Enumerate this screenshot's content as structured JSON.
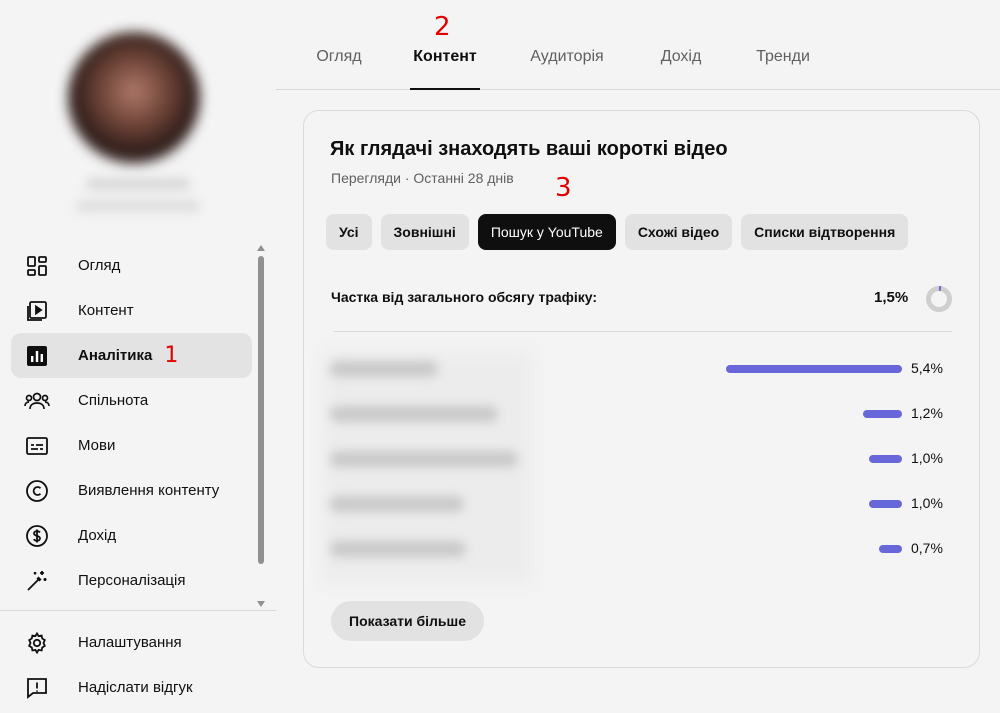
{
  "sidebar": {
    "items": [
      {
        "label": "Огляд",
        "icon": "dashboard-icon"
      },
      {
        "label": "Контент",
        "icon": "content-icon"
      },
      {
        "label": "Аналітика",
        "icon": "analytics-icon",
        "annotation": "1"
      },
      {
        "label": "Спільнота",
        "icon": "community-icon"
      },
      {
        "label": "Мови",
        "icon": "subtitles-icon"
      },
      {
        "label": "Виявлення контенту",
        "icon": "copyright-icon"
      },
      {
        "label": "Дохід",
        "icon": "dollar-icon"
      },
      {
        "label": "Персоналізація",
        "icon": "magic-wand-icon"
      }
    ],
    "bottom_items": [
      {
        "label": "Налаштування",
        "icon": "gear-icon"
      },
      {
        "label": "Надіслати відгук",
        "icon": "feedback-icon"
      }
    ]
  },
  "tabs": [
    {
      "label": "Огляд"
    },
    {
      "label": "Контент",
      "active": true,
      "annotation": "2"
    },
    {
      "label": "Аудиторія"
    },
    {
      "label": "Дохід"
    },
    {
      "label": "Тренди"
    }
  ],
  "card": {
    "title": "Як глядачі знаходять ваші короткі відео",
    "subtitle": "Перегляди · Останні 28 днів",
    "annotation": "3",
    "chips": [
      {
        "label": "Усі"
      },
      {
        "label": "Зовнішні"
      },
      {
        "label": "Пошук у YouTube",
        "active": true
      },
      {
        "label": "Схожі відео"
      },
      {
        "label": "Списки відтворення"
      }
    ],
    "share_label": "Частка від загального обсягу трафіку:",
    "share_value": "1,5%",
    "share_fraction": 0.015,
    "rows": [
      {
        "value": 5.4,
        "label": "5,4%"
      },
      {
        "value": 1.2,
        "label": "1,2%"
      },
      {
        "value": 1.0,
        "label": "1,0%"
      },
      {
        "value": 1.0,
        "label": "1,0%"
      },
      {
        "value": 0.7,
        "label": "0,7%"
      }
    ],
    "more_label": "Показати більше"
  },
  "colors": {
    "bar": "#6867d9",
    "annotation": "#e00000",
    "active_chip": "#0f0f0f"
  }
}
